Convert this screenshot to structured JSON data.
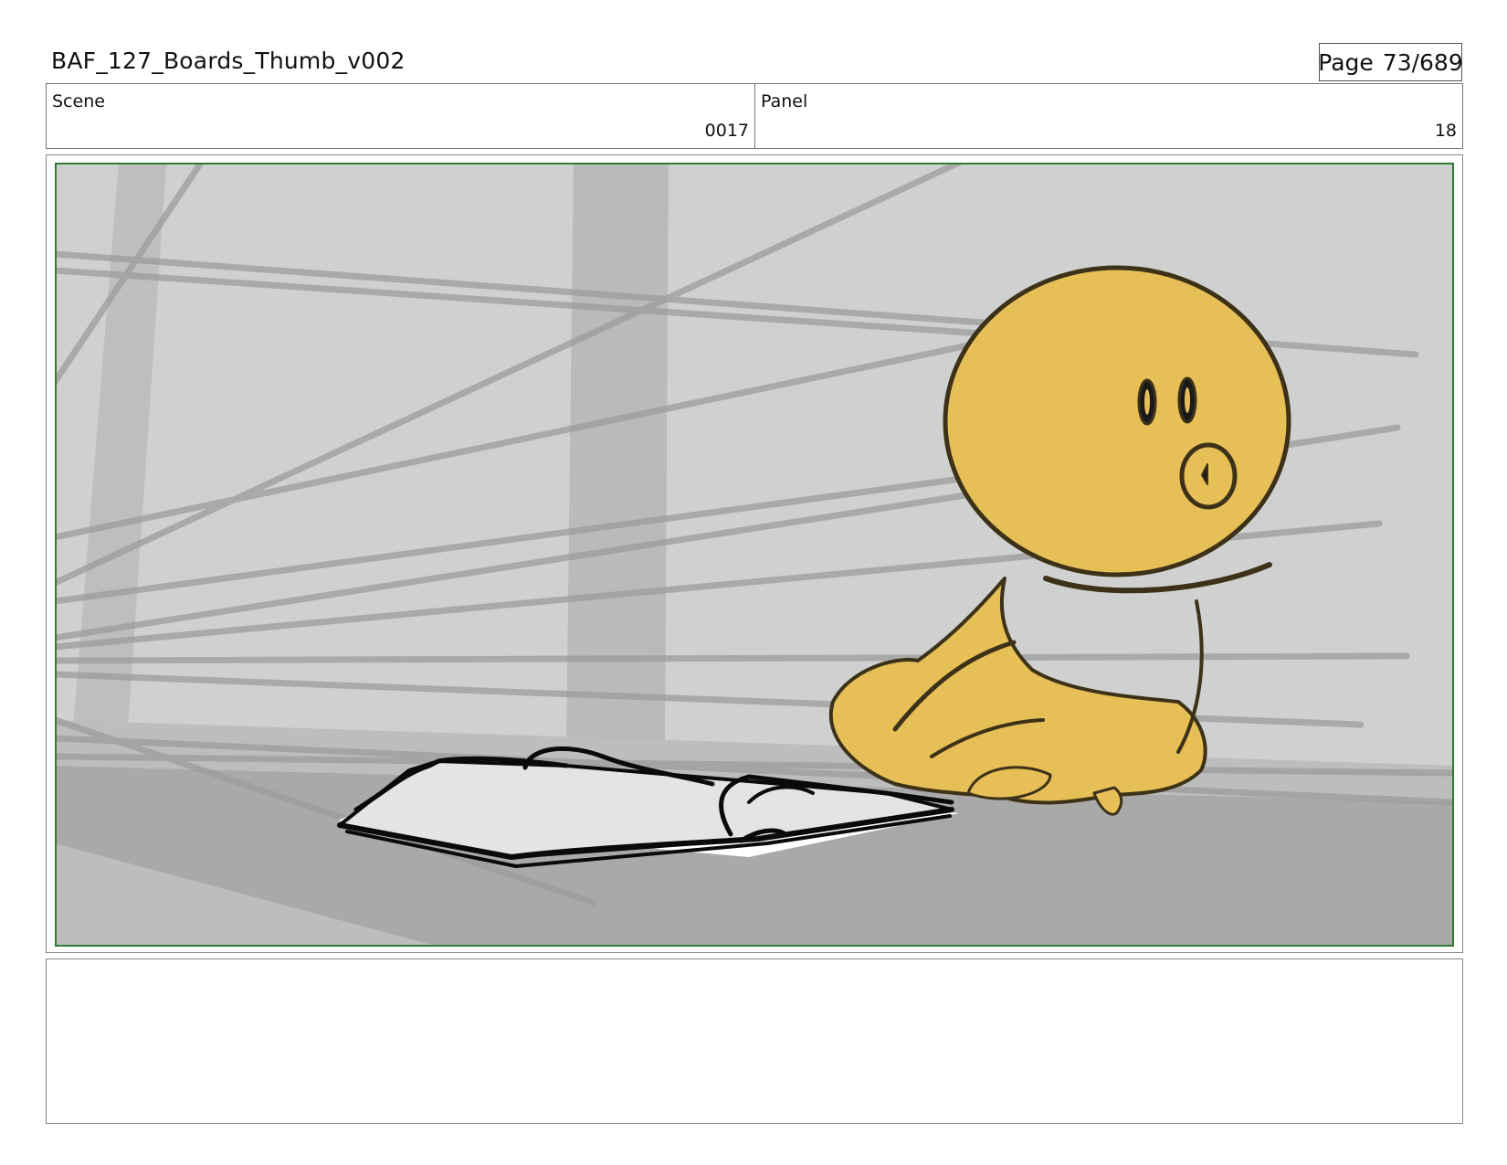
{
  "header": {
    "title": "BAF_127_Boards_Thumb_v002",
    "page_label": "Page",
    "page_value": "73/689"
  },
  "info": {
    "scene_label": "Scene",
    "scene_value": "0017",
    "panel_label": "Panel",
    "panel_value": "18"
  },
  "panel_image": {
    "frame_color": "#2e7d32",
    "background_color": "#cfd1d0",
    "floor_color": "#a9a9a9",
    "character_color": "#e6c057",
    "elements": [
      "sketch-background-lines",
      "open-book",
      "yellow-chick-character"
    ]
  },
  "notes": {
    "text": ""
  }
}
